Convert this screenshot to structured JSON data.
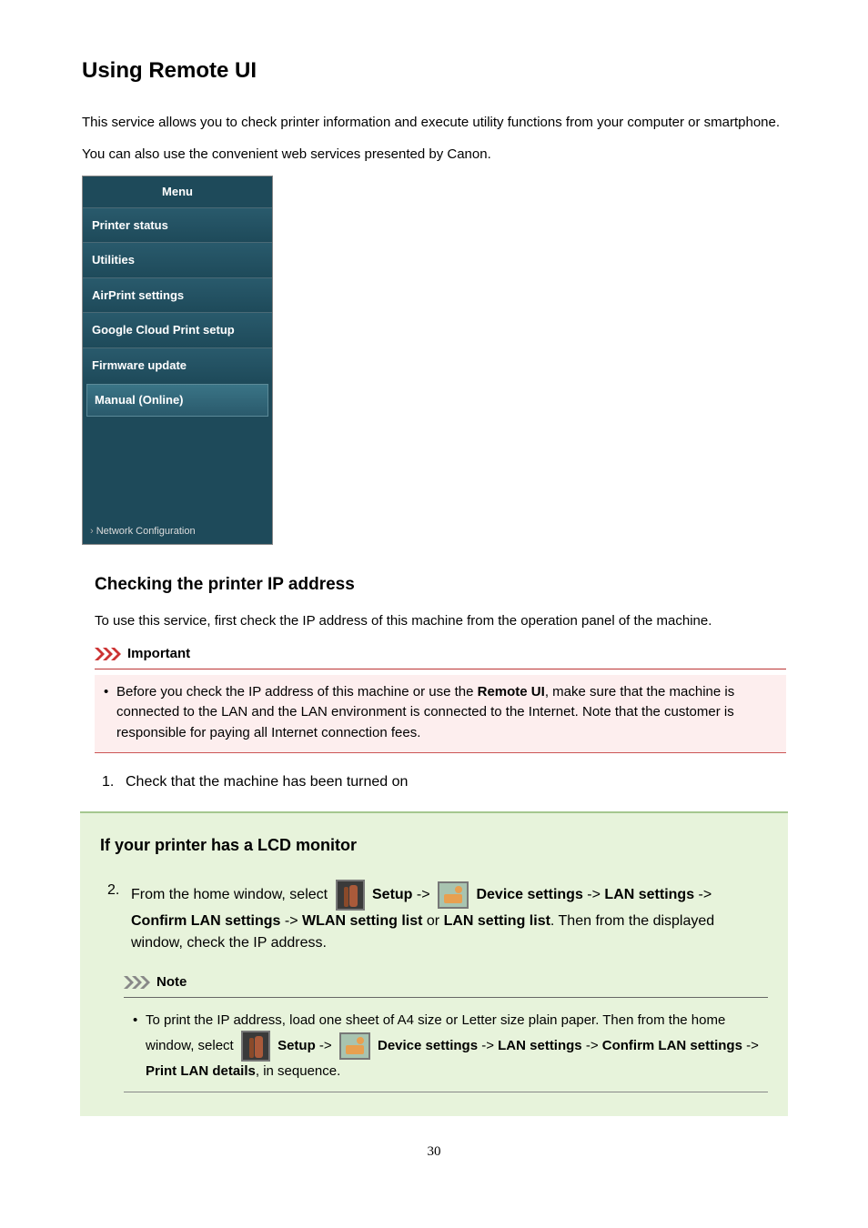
{
  "page": {
    "title": "Using Remote UI",
    "intro1": "This service allows you to check printer information and execute utility functions from your computer or smartphone.",
    "intro2": "You can also use the convenient web services presented by Canon.",
    "pageNumber": "30"
  },
  "menu": {
    "header": "Menu",
    "items": [
      "Printer status",
      "Utilities",
      "AirPrint settings",
      "Google Cloud Print setup",
      "Firmware update",
      "Manual (Online)"
    ],
    "footer": "Network Configuration"
  },
  "section1": {
    "heading": "Checking the printer IP address",
    "text": "To use this service, first check the IP address of this machine from the operation panel of the machine."
  },
  "important": {
    "label": "Important",
    "item1_pre": "Before you check the IP address of this machine or use the ",
    "item1_bold": "Remote UI",
    "item1_post": ", make sure that the machine is connected to the LAN and the LAN environment is connected to the Internet. Note that the customer is responsible for paying all Internet connection fees."
  },
  "steps": {
    "step1": "Check that the machine has been turned on"
  },
  "lcd_section": {
    "heading": "If your printer has a LCD monitor",
    "step2": {
      "pre": "From the home window, select ",
      "setup": "Setup",
      "arrow": " -> ",
      "device": "Device settings",
      "lan": "LAN settings",
      "confirm": "Confirm LAN settings",
      "wlan_list": "WLAN setting list",
      "or": " or ",
      "lan_list": "LAN setting list",
      "post": ". Then from the displayed window, check the IP address."
    }
  },
  "note": {
    "label": "Note",
    "item1_pre": "To print the IP address, load one sheet of A4 size or Letter size plain paper. Then from the home window, select ",
    "setup": "Setup",
    "arrow": " -> ",
    "device": "Device settings",
    "lan": "LAN settings",
    "confirm": "Confirm LAN settings",
    "print": "Print LAN details",
    "post": ", in sequence."
  }
}
